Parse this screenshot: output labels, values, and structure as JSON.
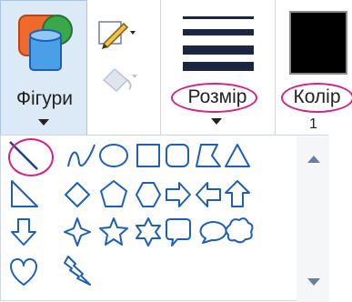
{
  "ribbon": {
    "shapes": {
      "label": "Фігури",
      "icon": "shapes-icon",
      "dropdown_icon": "chevron-down-icon"
    },
    "outline": {
      "icon": "pencil-outline-icon"
    },
    "fill": {
      "icon": "paint-bucket-fill-icon"
    },
    "size": {
      "label": "Розмір",
      "icon": "line-size-icon",
      "dropdown_icon": "chevron-down-icon"
    },
    "color": {
      "label": "Колір",
      "number": "1",
      "value": "#000000"
    }
  },
  "gallery": {
    "rows": [
      [
        "line",
        "curve",
        "oval",
        "rectangle",
        "rounded-rectangle",
        "polygon",
        "triangle"
      ],
      [
        "right-triangle",
        "diamond",
        "pentagon",
        "hexagon",
        "right-arrow",
        "left-arrow",
        "up-arrow"
      ],
      [
        "down-arrow",
        "four-point-star",
        "five-point-star",
        "six-point-star",
        "rounded-rect-callout",
        "oval-callout",
        "cloud-callout"
      ],
      [
        "heart",
        "lightning"
      ]
    ],
    "selected": "line",
    "scroll_up_icon": "scroll-up-icon",
    "scroll_down_icon": "scroll-down-icon"
  },
  "colors": {
    "shape_stroke": "#1e5fb4",
    "highlight": "#d4237f",
    "ribbon_group_bg": "#dce9f6"
  }
}
